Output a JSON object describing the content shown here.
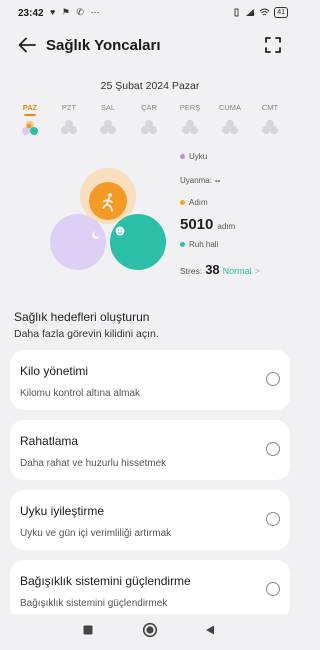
{
  "status": {
    "time": "23:42",
    "left_icons": "♥ ⚑ ✆ ⋯",
    "battery": "41"
  },
  "header": {
    "title": "Sağlık Yoncaları"
  },
  "date": "25 Şubat 2024 Pazar",
  "week": [
    {
      "label": "PAZ",
      "active": true
    },
    {
      "label": "PZT",
      "active": false
    },
    {
      "label": "SAL",
      "active": false
    },
    {
      "label": "ÇAR",
      "active": false
    },
    {
      "label": "PERŞ",
      "active": false
    },
    {
      "label": "CUMA",
      "active": false
    },
    {
      "label": "CMT",
      "active": false
    }
  ],
  "summary": {
    "sleep": {
      "label": "Uyku",
      "sub_label": "Uyanma:",
      "sub_value": "--",
      "color": "#b98ce8"
    },
    "steps": {
      "label": "Adım",
      "value": "5010",
      "unit": "adım",
      "color": "#f5a623"
    },
    "mood": {
      "label": "Ruh hali",
      "color": "#2bbfa8"
    },
    "stress": {
      "label": "Stres:",
      "value": "38",
      "status": "Normal",
      "chevron": ">"
    }
  },
  "goals": {
    "title": "Sağlık hedefleri oluşturun",
    "subtitle": "Daha fazla görevin kilidini açın.",
    "items": [
      {
        "title": "Kilo yönetimi",
        "desc": "Kilomu kontrol altına almak"
      },
      {
        "title": "Rahatlama",
        "desc": "Daha rahat ve huzurlu hissetmek"
      },
      {
        "title": "Uyku iyileştirme",
        "desc": "Uyku ve gün içi verimliliği artırmak"
      },
      {
        "title": "Bağışıklık sistemini güçlendirme",
        "desc": "Bağışıklık sistemini güçlendirmek"
      }
    ]
  },
  "colors": {
    "accent": "#f08a1a",
    "sleep_petal": "#d8c8f2",
    "steps_petal": "#f59a24",
    "steps_halo": "#f9dfbf",
    "mood_petal": "#2bbfa8"
  }
}
